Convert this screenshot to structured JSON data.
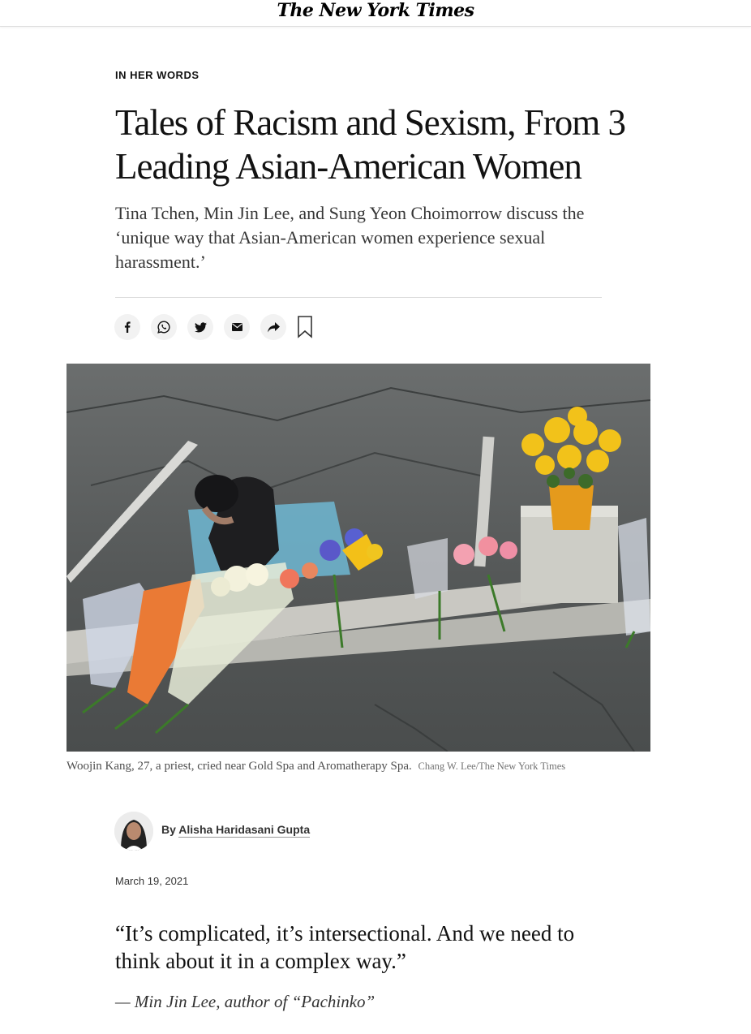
{
  "masthead": {
    "logo_text": "The New York Times"
  },
  "article": {
    "kicker": "IN HER WORDS",
    "headline": "Tales of Racism and Sexism, From 3 Leading Asian-American Women",
    "summary": "Tina Tchen, Min Jin Lee, and Sung Yeon Choimorrow discuss the ‘unique way that Asian-American women experience sexual harassment.’"
  },
  "share_tools": {
    "buttons": [
      {
        "name": "facebook",
        "icon": "facebook-icon"
      },
      {
        "name": "whatsapp",
        "icon": "whatsapp-icon"
      },
      {
        "name": "twitter",
        "icon": "twitter-icon"
      },
      {
        "name": "email",
        "icon": "email-icon"
      },
      {
        "name": "more",
        "icon": "share-arrow-icon"
      }
    ],
    "bookmark_icon": "bookmark-icon"
  },
  "photo": {
    "caption": "Woojin Kang, 27, a priest, cried near Gold Spa and Aromatherapy Spa.",
    "credit": "Chang W. Lee/The New York Times"
  },
  "byline": {
    "prefix": "By",
    "author": "Alisha Haridasani Gupta"
  },
  "date": "March 19, 2021",
  "pullquote": {
    "text": "“It’s complicated, it’s intersectional. And we need to think about it in a complex way.”",
    "attribution": "— Min Jin Lee, author of “Pachinko”"
  },
  "colors": {
    "text": "#121212",
    "summary": "#363636",
    "share_button_bg": "#f2f2f2",
    "divider": "#dcdcdc"
  }
}
